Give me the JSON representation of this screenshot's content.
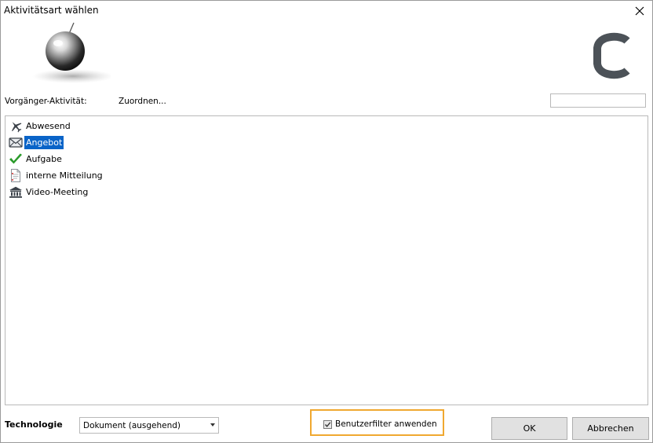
{
  "window": {
    "title": "Aktivitätsart wählen"
  },
  "header": {
    "predecessor_label": "Vorgänger-Aktivität:",
    "assign_link": "Zuordnen...",
    "search": {
      "value": "",
      "placeholder": ""
    }
  },
  "activity_types": [
    {
      "label": "Abwesend",
      "icon": "airplane-icon",
      "selected": false
    },
    {
      "label": "Angebot",
      "icon": "envelope-icon",
      "selected": true
    },
    {
      "label": "Aufgabe",
      "icon": "checkmark-icon",
      "selected": false
    },
    {
      "label": "interne Mitteilung",
      "icon": "document-icon",
      "selected": false
    },
    {
      "label": "Video-Meeting",
      "icon": "building-icon",
      "selected": false
    }
  ],
  "footer": {
    "technology_label": "Technologie",
    "technology_value": "Dokument (ausgehend)",
    "filter_label": "Benutzerfilter anwenden",
    "filter_checked": true,
    "ok_label": "OK",
    "cancel_label": "Abbrechen"
  },
  "colors": {
    "selection": "#0a64c8",
    "highlight_border": "#f0a830",
    "check_green": "#2a9a2a",
    "logo": "#4c5258"
  }
}
